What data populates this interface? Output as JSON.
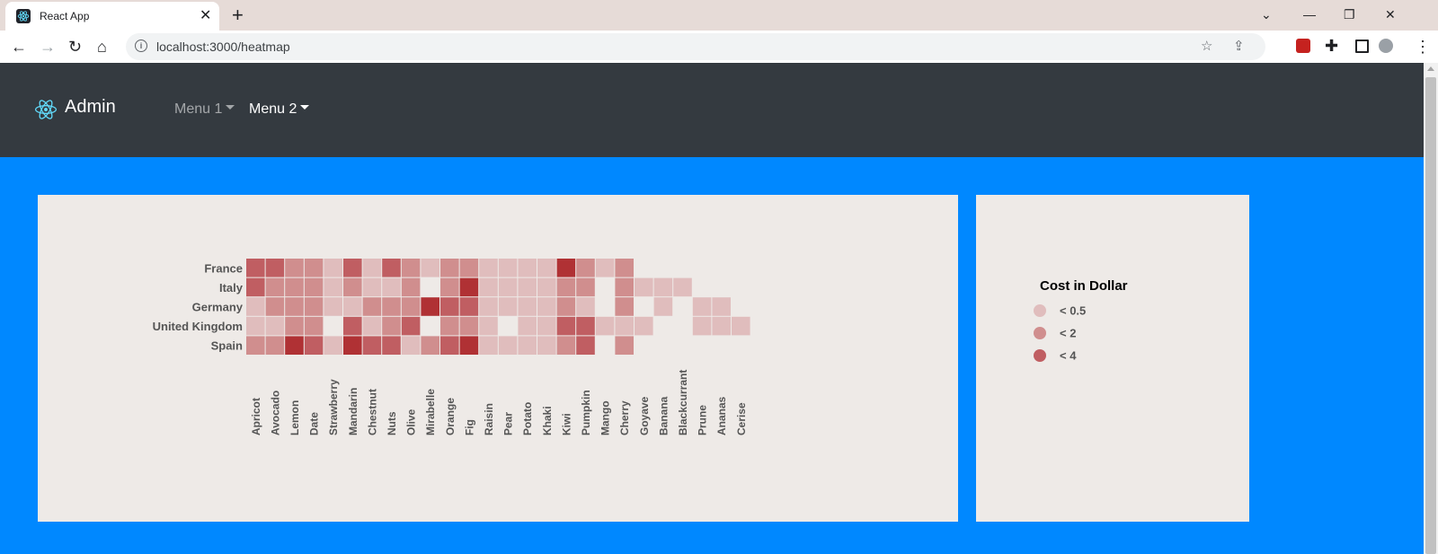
{
  "browser": {
    "tab_title": "React App",
    "url": "localhost:3000/heatmap"
  },
  "app": {
    "brand": "Admin",
    "menus": [
      {
        "label": "Menu 1"
      },
      {
        "label": "Menu 2"
      }
    ]
  },
  "chart_data": {
    "type": "heatmap",
    "rows": [
      "France",
      "Italy",
      "Germany",
      "United Kingdom",
      "Spain"
    ],
    "columns": [
      "Apricot",
      "Avocado",
      "Lemon",
      "Date",
      "Strawberry",
      "Mandarin",
      "Chestnut",
      "Nuts",
      "Olive",
      "Mirabelle",
      "Orange",
      "Fig",
      "Raisin",
      "Pear",
      "Potato",
      "Khaki",
      "Kiwi",
      "Pumpkin",
      "Mango",
      "Cherry",
      "Goyave",
      "Banana",
      "Blackcurrant",
      "Prune",
      "Ananas",
      "Cerise"
    ],
    "levels": [
      [
        3,
        3,
        2,
        2,
        1,
        3,
        1,
        3,
        2,
        1,
        2,
        2,
        1,
        1,
        1,
        1,
        4,
        2,
        1,
        2,
        0,
        0,
        0,
        0,
        0,
        0
      ],
      [
        3,
        2,
        2,
        2,
        1,
        2,
        1,
        1,
        2,
        0,
        2,
        4,
        1,
        1,
        1,
        1,
        2,
        2,
        0,
        2,
        1,
        1,
        1,
        0,
        0,
        0
      ],
      [
        1,
        2,
        2,
        2,
        1,
        1,
        2,
        2,
        2,
        4,
        3,
        3,
        1,
        1,
        1,
        1,
        2,
        1,
        0,
        2,
        0,
        1,
        0,
        1,
        1,
        0
      ],
      [
        1,
        1,
        2,
        2,
        0,
        3,
        1,
        2,
        3,
        0,
        2,
        2,
        1,
        0,
        1,
        1,
        3,
        3,
        1,
        1,
        1,
        0,
        0,
        1,
        1,
        1
      ],
      [
        2,
        2,
        4,
        3,
        1,
        4,
        3,
        3,
        1,
        2,
        3,
        4,
        1,
        1,
        1,
        1,
        2,
        3,
        0,
        2,
        0,
        0,
        0,
        0,
        0,
        0
      ]
    ],
    "level_colors": [
      "#e0bdbd",
      "#d08e8e",
      "#c05e62",
      "#b03134"
    ],
    "legend": {
      "title": "Cost in Dollar",
      "entries": [
        {
          "label": "< 0.5",
          "color": "#e0bdbd"
        },
        {
          "label": "< 2",
          "color": "#d08e8e"
        },
        {
          "label": "< 4",
          "color": "#c05e62"
        }
      ]
    }
  }
}
